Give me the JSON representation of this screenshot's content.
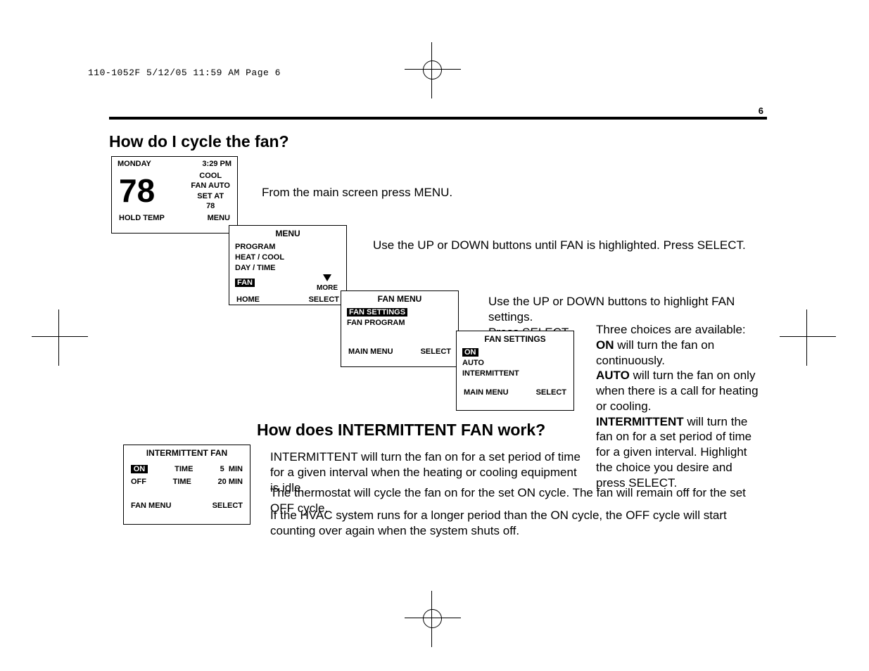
{
  "printHeader": "110-1052F  5/12/05  11:59 AM  Page 6",
  "pageNumber": "6",
  "heading1": "How do I cycle the fan?",
  "heading2": "How does INTERMITTENT FAN work?",
  "instr1": "From the main screen press MENU.",
  "instr2": "Use the UP or DOWN buttons until FAN is highlighted. Press SELECT.",
  "instr3a": "Use the UP or DOWN buttons to highlight FAN settings.",
  "instr3b": "Press SELECT.",
  "side_text": {
    "l1": "Three choices are available:",
    "on": "ON",
    "on_rest": " will turn the fan on continuously.",
    "auto": "AUTO",
    "auto_rest": " will turn the fan on only when there is a call for heating or cooling.",
    "int": "INTERMITTENT",
    "int_rest": " will turn the fan on for a set period of time for a given interval. Highlight the choice you desire and press SELECT."
  },
  "para1": "INTERMITTENT will turn the fan on for a set period of time for a given interval when the heating or cooling equipment is idle.",
  "para2": "The thermostat will cycle the fan on for the set ON cycle. The fan will remain off for the set OFF cycle.",
  "para3": "If the HVAC system runs for a longer period than the ON cycle, the OFF cycle will start counting over again when the system shuts off.",
  "s1": {
    "day": "MONDAY",
    "time": "3:29 PM",
    "temp": "78",
    "mode": "COOL",
    "fan": "FAN AUTO",
    "setat": "SET AT",
    "setpt": "78",
    "b1": "HOLD TEMP",
    "b2": "MENU"
  },
  "s2": {
    "title": "MENU",
    "i1": "PROGRAM",
    "i2": "HEAT / COOL",
    "i3": "DAY / TIME",
    "i4": "FAN",
    "more": "MORE",
    "b1": "HOME",
    "b2": "SELECT"
  },
  "s3": {
    "title": "FAN MENU",
    "i1": "FAN SETTINGS",
    "i2": "FAN PROGRAM",
    "b1": "MAIN MENU",
    "b2": "SELECT"
  },
  "s4": {
    "title": "FAN SETTINGS",
    "i1": "ON",
    "i2": "AUTO",
    "i3": "INTERMITTENT",
    "b1": "MAIN MENU",
    "b2": "SELECT"
  },
  "s5": {
    "title": "INTERMITTENT FAN",
    "on": "ON",
    "off": "OFF",
    "timelbl": "TIME",
    "on_v": "5",
    "on_u": "MIN",
    "off_v": "20",
    "off_u": "MIN",
    "b1": "FAN MENU",
    "b2": "SELECT"
  }
}
